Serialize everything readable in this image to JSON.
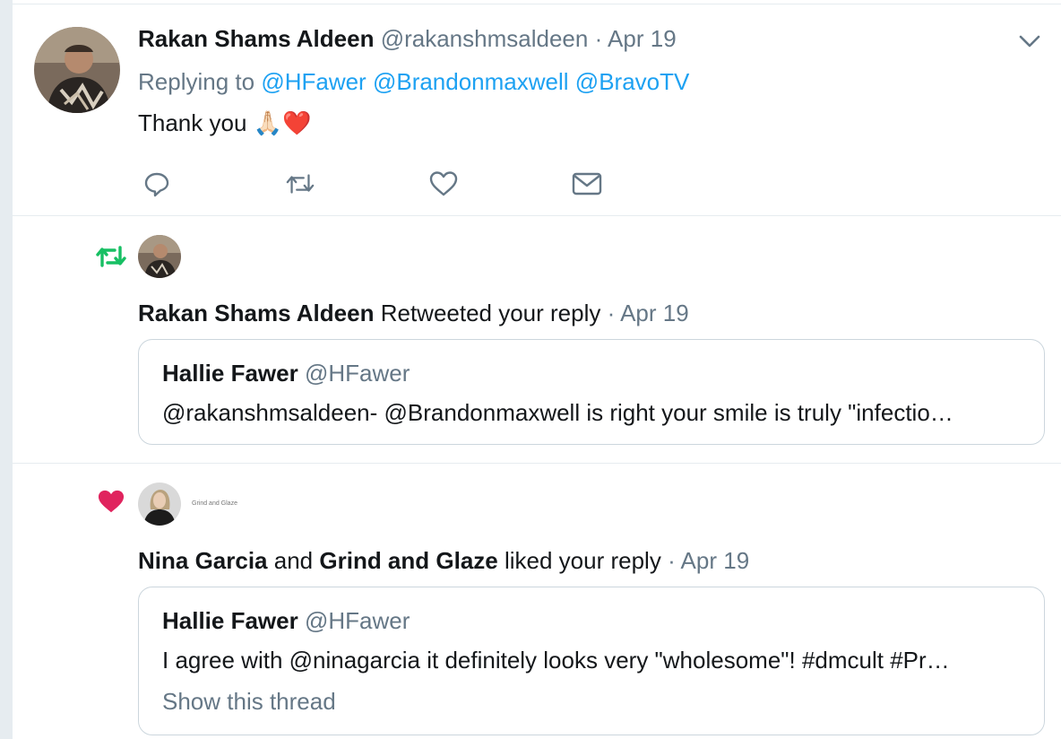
{
  "tweet": {
    "author_name": "Rakan Shams Aldeen",
    "author_handle": "@rakanshmsaldeen",
    "separator": "·",
    "date": "Apr 19",
    "replying_label": "Replying to",
    "reply_mentions": [
      "@HFawer",
      "@Brandonmaxwell",
      "@BravoTV"
    ],
    "text": "Thank you",
    "emoji": [
      "🙏🏻",
      "❤️"
    ],
    "actions": [
      "reply-icon",
      "retweet-icon",
      "like-icon",
      "dm-icon"
    ]
  },
  "notif_retweet": {
    "icon": "retweet-icon",
    "actor": "Rakan Shams Aldeen",
    "action_text": "Retweeted your reply",
    "separator": "·",
    "date": "Apr 19",
    "quote": {
      "author_name": "Hallie Fawer",
      "author_handle": "@HFawer",
      "text": "@rakanshmsaldeen- @Brandonmaxwell is right your smile is truly \"infectio…"
    }
  },
  "notif_like": {
    "icon": "heart-icon",
    "avatar2_text": "Grind and Glaze",
    "actor1": "Nina Garcia",
    "conjunction": "and",
    "actor2": "Grind and Glaze",
    "action_text": "liked your reply",
    "separator": "·",
    "date": "Apr 19",
    "quote": {
      "author_name": "Hallie Fawer",
      "author_handle": "@HFawer",
      "text": "I agree with @ninagarcia it definitely looks very \"wholesome\"! #dmcult #Pr…",
      "show_thread": "Show this thread"
    }
  },
  "colors": {
    "accent": "#1da1f2",
    "retweet_green": "#17bf63",
    "like_red": "#e0245e",
    "muted": "#657786"
  }
}
